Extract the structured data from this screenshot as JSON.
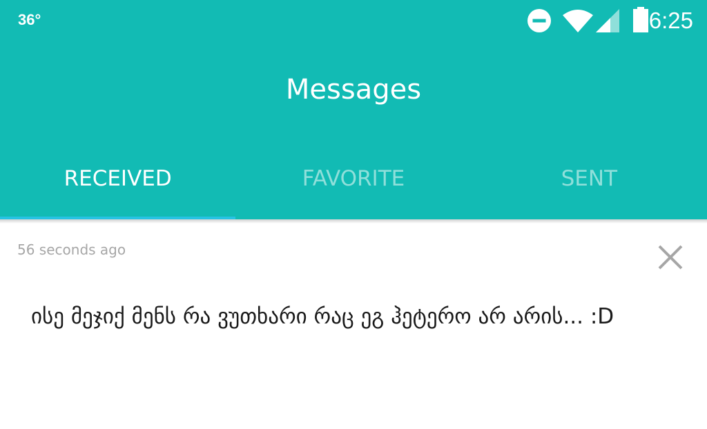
{
  "status_bar": {
    "temperature": "36°",
    "time": "6:25",
    "icons": [
      "do-not-disturb-icon",
      "wifi-icon",
      "signal-icon",
      "battery-icon"
    ]
  },
  "header": {
    "title": "Messages"
  },
  "tabs": [
    {
      "label": "RECEIVED",
      "active": true
    },
    {
      "label": "FAVORITE",
      "active": false
    },
    {
      "label": "SENT",
      "active": false
    }
  ],
  "message": {
    "timestamp": "56 seconds ago",
    "text": "ისე მეჯიქ მენს რა ვუთხარი რაც ეგ ჰეტერო არ არის... :D",
    "dismiss_icon": "close-icon"
  },
  "colors": {
    "header_bg": "#12bbb4",
    "tab_active": "#ffffff",
    "tab_inactive": "#8fdfda",
    "tab_indicator": "#27c3e3",
    "timestamp": "#a6a6a6",
    "message_text": "#1a1a1a"
  }
}
